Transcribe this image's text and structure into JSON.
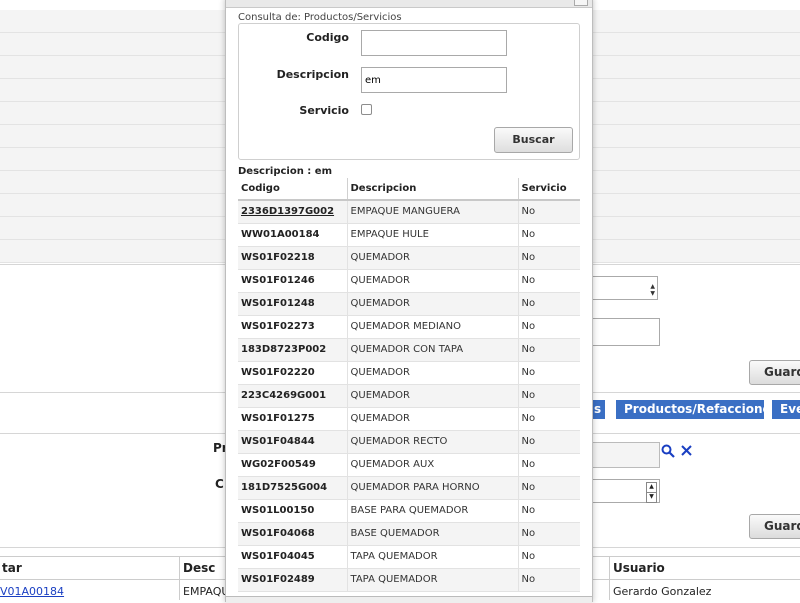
{
  "background": {
    "buttons": {
      "guardar_1": "Guardar",
      "guardar_2": "Guardar"
    },
    "tabs": [
      "s",
      "Productos/Refacciones",
      "Eve"
    ],
    "labels": {
      "producto_partial": "Pr",
      "cantidad_partial": "C"
    },
    "table": {
      "headers": {
        "col1": "tar",
        "col2": "Desc",
        "col3": "Usuario"
      },
      "row": {
        "col1": "V01A00184",
        "col2": "EMPAQU",
        "col3": "Gerardo Gonzalez"
      }
    },
    "link_color": "#1a3fc2",
    "tab_color": "#3a6fc4"
  },
  "modal": {
    "subtitle": "Consulta de: Productos/Servicios",
    "form": {
      "codigo_label": "Codigo",
      "codigo_value": "",
      "descripcion_label": "Descripcion",
      "descripcion_value": "em",
      "servicio_label": "Servicio",
      "servicio_checked": false,
      "buscar_label": "Buscar"
    },
    "results_title": "Descripcion : em",
    "columns": [
      "Codigo",
      "Descripcion",
      "Servicio"
    ],
    "rows": [
      {
        "codigo": "2336D1397G002",
        "descripcion": "EMPAQUE MANGUERA",
        "servicio": "No"
      },
      {
        "codigo": "WW01A00184",
        "descripcion": "EMPAQUE HULE",
        "servicio": "No"
      },
      {
        "codigo": "WS01F02218",
        "descripcion": "QUEMADOR",
        "servicio": "No"
      },
      {
        "codigo": "WS01F01246",
        "descripcion": "QUEMADOR",
        "servicio": "No"
      },
      {
        "codigo": "WS01F01248",
        "descripcion": "QUEMADOR",
        "servicio": "No"
      },
      {
        "codigo": "WS01F02273",
        "descripcion": "QUEMADOR MEDIANO",
        "servicio": "No"
      },
      {
        "codigo": "183D8723P002",
        "descripcion": "QUEMADOR CON TAPA",
        "servicio": "No"
      },
      {
        "codigo": "WS01F02220",
        "descripcion": "QUEMADOR",
        "servicio": "No"
      },
      {
        "codigo": "223C4269G001",
        "descripcion": "QUEMADOR",
        "servicio": "No"
      },
      {
        "codigo": "WS01F01275",
        "descripcion": "QUEMADOR",
        "servicio": "No"
      },
      {
        "codigo": "WS01F04844",
        "descripcion": "QUEMADOR RECTO",
        "servicio": "No"
      },
      {
        "codigo": "WG02F00549",
        "descripcion": "QUEMADOR AUX",
        "servicio": "No"
      },
      {
        "codigo": "181D7525G004",
        "descripcion": "QUEMADOR PARA HORNO",
        "servicio": "No"
      },
      {
        "codigo": "WS01L00150",
        "descripcion": "BASE PARA QUEMADOR",
        "servicio": "No"
      },
      {
        "codigo": "WS01F04068",
        "descripcion": "BASE QUEMADOR",
        "servicio": "No"
      },
      {
        "codigo": "WS01F04045",
        "descripcion": "TAPA QUEMADOR",
        "servicio": "No"
      },
      {
        "codigo": "WS01F02489",
        "descripcion": "TAPA QUEMADOR",
        "servicio": "No"
      }
    ]
  }
}
